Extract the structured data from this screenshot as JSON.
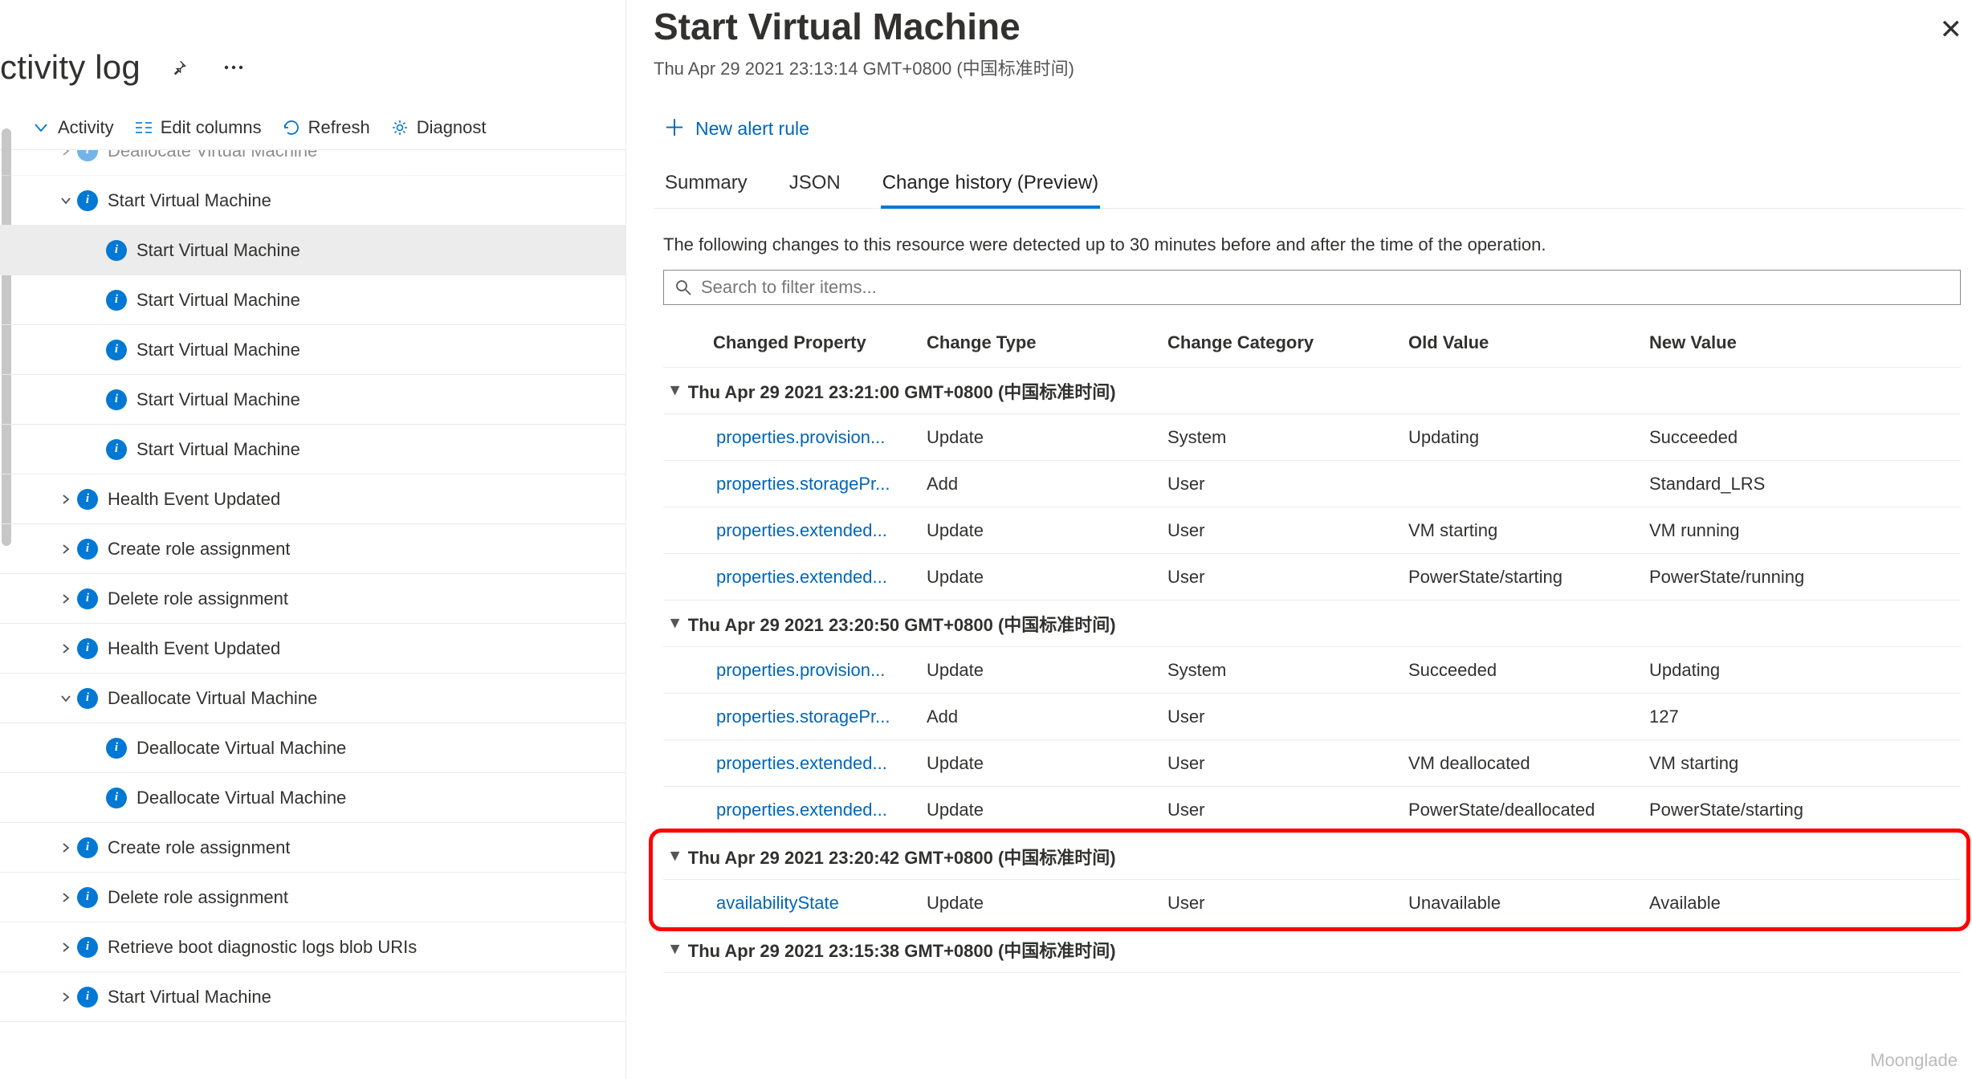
{
  "left": {
    "title": "ctivity log",
    "toolbar": {
      "activity": "Activity",
      "editColumns": "Edit columns",
      "refresh": "Refresh",
      "diagnostics": "Diagnost"
    },
    "tree": [
      {
        "indent": 68,
        "chevron": "right",
        "label": "Deallocate Virtual Machine",
        "dim": true
      },
      {
        "indent": 68,
        "chevron": "down",
        "label": "Start Virtual Machine"
      },
      {
        "indent": 104,
        "chevron": "",
        "label": "Start Virtual Machine",
        "selected": true
      },
      {
        "indent": 104,
        "chevron": "",
        "label": "Start Virtual Machine"
      },
      {
        "indent": 104,
        "chevron": "",
        "label": "Start Virtual Machine"
      },
      {
        "indent": 104,
        "chevron": "",
        "label": "Start Virtual Machine"
      },
      {
        "indent": 104,
        "chevron": "",
        "label": "Start Virtual Machine"
      },
      {
        "indent": 68,
        "chevron": "right",
        "label": "Health Event Updated"
      },
      {
        "indent": 68,
        "chevron": "right",
        "label": "Create role assignment"
      },
      {
        "indent": 68,
        "chevron": "right",
        "label": "Delete role assignment"
      },
      {
        "indent": 68,
        "chevron": "right",
        "label": "Health Event Updated"
      },
      {
        "indent": 68,
        "chevron": "down",
        "label": "Deallocate Virtual Machine"
      },
      {
        "indent": 104,
        "chevron": "",
        "label": "Deallocate Virtual Machine"
      },
      {
        "indent": 104,
        "chevron": "",
        "label": "Deallocate Virtual Machine"
      },
      {
        "indent": 68,
        "chevron": "right",
        "label": "Create role assignment"
      },
      {
        "indent": 68,
        "chevron": "right",
        "label": "Delete role assignment"
      },
      {
        "indent": 68,
        "chevron": "right",
        "label": "Retrieve boot diagnostic logs blob URIs"
      },
      {
        "indent": 68,
        "chevron": "right",
        "label": "Start Virtual Machine"
      }
    ]
  },
  "right": {
    "title": "Start Virtual Machine",
    "subtitle": "Thu Apr 29 2021 23:13:14 GMT+0800 (中国标准时间)",
    "newAlert": "New alert rule",
    "tabs": {
      "summary": "Summary",
      "json": "JSON",
      "changeHistory": "Change history (Preview)"
    },
    "desc": "The following changes to this resource were detected up to 30 minutes before and after the time of the operation.",
    "searchPlaceholder": "Search to filter items...",
    "columns": {
      "changedProperty": "Changed Property",
      "changeType": "Change Type",
      "changeCategory": "Change Category",
      "oldValue": "Old Value",
      "newValue": "New Value"
    },
    "groups": [
      {
        "ts": "Thu Apr 29 2021 23:21:00 GMT+0800 (中国标准时间)",
        "rows": [
          {
            "prop": "properties.provision...",
            "type": "Update",
            "cat": "System",
            "old": "Updating",
            "new": "Succeeded"
          },
          {
            "prop": "properties.storagePr...",
            "type": "Add",
            "cat": "User",
            "old": "",
            "new": "Standard_LRS"
          },
          {
            "prop": "properties.extended...",
            "type": "Update",
            "cat": "User",
            "old": "VM starting",
            "new": "VM running"
          },
          {
            "prop": "properties.extended...",
            "type": "Update",
            "cat": "User",
            "old": "PowerState/starting",
            "new": "PowerState/running"
          }
        ]
      },
      {
        "ts": "Thu Apr 29 2021 23:20:50 GMT+0800 (中国标准时间)",
        "rows": [
          {
            "prop": "properties.provision...",
            "type": "Update",
            "cat": "System",
            "old": "Succeeded",
            "new": "Updating"
          },
          {
            "prop": "properties.storagePr...",
            "type": "Add",
            "cat": "User",
            "old": "",
            "new": "127"
          },
          {
            "prop": "properties.extended...",
            "type": "Update",
            "cat": "User",
            "old": "VM deallocated",
            "new": "VM starting"
          },
          {
            "prop": "properties.extended...",
            "type": "Update",
            "cat": "User",
            "old": "PowerState/deallocated",
            "new": "PowerState/starting"
          }
        ]
      },
      {
        "ts": "Thu Apr 29 2021 23:20:42 GMT+0800 (中国标准时间)",
        "highlight": true,
        "rows": [
          {
            "prop": "availabilityState",
            "type": "Update",
            "cat": "User",
            "old": "Unavailable",
            "new": "Available"
          }
        ]
      },
      {
        "ts": "Thu Apr 29 2021 23:15:38 GMT+0800 (中国标准时间)",
        "rows": []
      }
    ]
  },
  "watermark": "Moonglade"
}
